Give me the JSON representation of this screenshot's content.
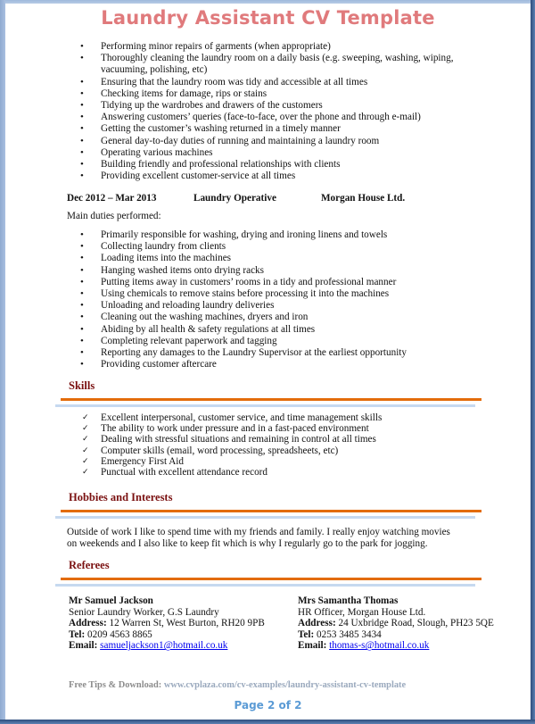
{
  "document": {
    "title": "Laundry Assistant CV Template",
    "title_color": "#e07a7c"
  },
  "previous_duties": [
    "Performing minor repairs of garments (when appropriate)",
    "Thoroughly cleaning the laundry room on a daily basis (e.g. sweeping, washing, wiping, vacuuming, polishing, etc)",
    "Ensuring that the laundry room was tidy and accessible at all times",
    "Checking items for damage, rips or stains",
    "Tidying up the wardrobes and drawers of the customers",
    "Answering customers’ queries (face-to-face, over the phone and through e-mail)",
    "Getting the customer’s washing returned in a timely manner",
    "General day-to-day duties of running and maintaining a laundry room",
    "Operating various machines",
    "Building friendly and professional relationships with clients",
    "Providing excellent customer-service at all times"
  ],
  "job": {
    "dates": "Dec 2012 – Mar 2013",
    "role": "Laundry Operative",
    "company": "Morgan House Ltd.",
    "duties_intro": "Main duties performed:",
    "duties": [
      "Primarily responsible for washing, drying and ironing linens and towels",
      "Collecting laundry from clients",
      "Loading items into the machines",
      "Hanging washed items onto drying racks",
      "Putting items away in customers’ rooms in a tidy and professional manner",
      "Using chemicals to remove stains before processing it into the machines",
      "Unloading and reloading laundry deliveries",
      "Cleaning out the washing machines, dryers and iron",
      "Abiding by all health & safety regulations at all times",
      "Completing relevant paperwork and tagging",
      "Reporting any damages to the Laundry Supervisor at the earliest opportunity",
      "Providing customer aftercare"
    ]
  },
  "skills": {
    "heading": "Skills",
    "items": [
      "Excellent interpersonal, customer service, and time management skills",
      "The ability to work under pressure and in a fast-paced environment",
      "Dealing with stressful situations and remaining in control at all times",
      "Computer skills (email, word processing, spreadsheets, etc)",
      "Emergency First Aid",
      "Punctual with excellent attendance record"
    ]
  },
  "hobbies": {
    "heading": "Hobbies and Interests",
    "text": "Outside of work I like to spend time with my friends and family. I really enjoy watching movies on weekends and I also like to keep fit which is why I regularly go to the park for jogging."
  },
  "referees": {
    "heading": "Referees",
    "address_label": "Address:",
    "tel_label": "Tel:",
    "email_label": "Email:",
    "people": [
      {
        "name": "Mr Samuel Jackson",
        "position": "Senior Laundry Worker, G.S Laundry",
        "address": "12 Warren St, West Burton, RH20 9PB",
        "tel": "0209 4563 8865",
        "email": "samueljackson1@hotmail.co.uk"
      },
      {
        "name": "Mrs Samantha Thomas",
        "position": "HR Officer, Morgan House Ltd.",
        "address": "24 Uxbridge Road, Slough, PH23 5QE",
        "tel": "0253 3485 3434",
        "email": "thomas-s@hotmail.co.uk"
      }
    ]
  },
  "footer": {
    "tips_label": "Free Tips & Download:",
    "tips_url": "www.cvplaza.com/cv-examples/laundry-assistant-cv-template",
    "page_indicator": "Page 2 of 2"
  },
  "colors": {
    "section_heading": "#7a1010",
    "rule_orange": "#e36c0a",
    "rule_blue": "#c6d9f0",
    "link": "#0000ee",
    "page_number": "#5b9bd5"
  }
}
